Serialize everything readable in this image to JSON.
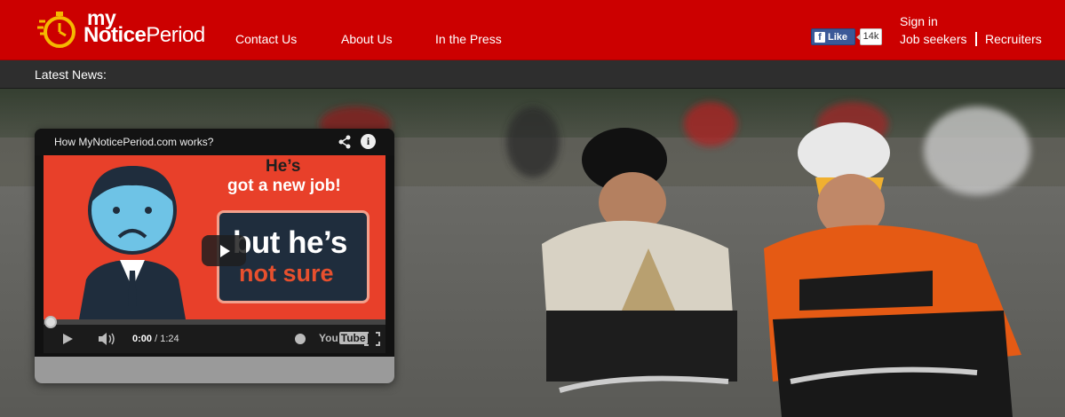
{
  "brand": {
    "logo_my": "my",
    "logo_notice": "Notice",
    "logo_period": "Period"
  },
  "nav": {
    "contact": "Contact Us",
    "about": "About Us",
    "press": "In the Press"
  },
  "social": {
    "like_label": "Like",
    "like_count": "14k"
  },
  "account": {
    "sign_in": "Sign in",
    "job_seekers": "Job seekers",
    "recruiters": "Recruiters"
  },
  "news": {
    "label": "Latest News:"
  },
  "video": {
    "title": "How MyNoticePeriod.com works?",
    "frame_line1": "He’s",
    "frame_line2": "got a new job!",
    "frame_box1": "but he’s",
    "frame_box2": "not sure",
    "time_current": "0:00",
    "time_total": " / 1:24",
    "youtube_label": "You",
    "youtube_tube": "Tube",
    "progress": 0
  },
  "colors": {
    "brand_red": "#cc0000",
    "newsbar": "#2e2e2e",
    "facebook": "#3b5998",
    "video_bg": "#e8402a"
  }
}
